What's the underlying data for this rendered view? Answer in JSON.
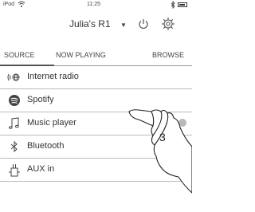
{
  "status_bar": {
    "carrier": "iPod",
    "time": "11:25"
  },
  "header": {
    "device_name": "Julia's R1",
    "dropdown_glyph": "▼"
  },
  "tabs": [
    {
      "label": "SOURCE",
      "active": true
    },
    {
      "label": "NOW PLAYING",
      "active": false
    },
    {
      "label": "BROWSE",
      "active": false
    }
  ],
  "sources": [
    {
      "label": "Internet radio",
      "icon": "internet-radio-icon"
    },
    {
      "label": "Spotify",
      "icon": "spotify-icon"
    },
    {
      "label": "Music player",
      "icon": "music-note-icon",
      "selected": true
    },
    {
      "label": "Bluetooth",
      "icon": "bluetooth-icon"
    },
    {
      "label": "AUX in",
      "icon": "aux-in-icon"
    }
  ],
  "callout": {
    "number": "3"
  },
  "colors": {
    "text": "#333333",
    "divider": "#bbbbbb",
    "selected_dot": "#b9b9b9"
  }
}
